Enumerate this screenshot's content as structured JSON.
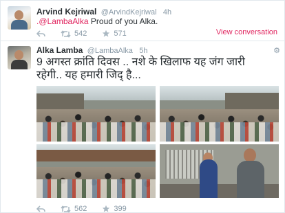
{
  "tweets": [
    {
      "name": "Arvind Kejriwal",
      "handle": "@ArvindKejriwal",
      "time": "4h",
      "mention": ".@LambaAlka",
      "text": " Proud of you Alka.",
      "retweets": "542",
      "favorites": "571",
      "view_conversation": "View conversation"
    },
    {
      "name": "Alka Lamba",
      "handle": "@LambaAlka",
      "time": "5h",
      "text": "9 अगस्त क्रांति दिवस .. नशे के खिलाफ यह जंग जारी रहेगी.. यह हमारी जिद् है...",
      "retweets": "562",
      "favorites": "399"
    }
  ],
  "icons": {
    "reply": "reply-icon",
    "retweet": "retweet-icon",
    "favorite": "star-icon"
  },
  "colors": {
    "link": "#e0245e",
    "muted": "#8899a6",
    "text": "#292f33"
  }
}
